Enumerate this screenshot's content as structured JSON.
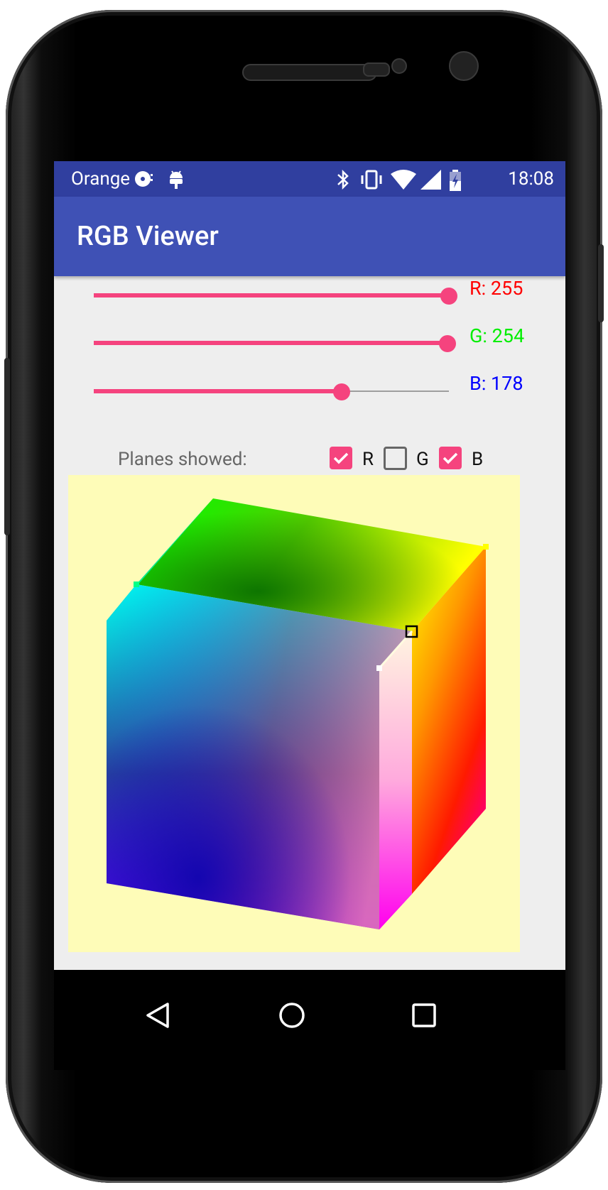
{
  "status_bar": {
    "carrier": "Orange",
    "time": "18:08"
  },
  "app_bar": {
    "title": "RGB Viewer"
  },
  "sliders": [
    {
      "label": "R: 255",
      "value": 255,
      "max": 255,
      "color": "#ff0000"
    },
    {
      "label": "G: 254",
      "value": 254,
      "max": 255,
      "color": "#00ee00"
    },
    {
      "label": "B: 178",
      "value": 178,
      "max": 255,
      "color": "#0000ff"
    }
  ],
  "planes": {
    "label": "Planes showed:",
    "options": [
      {
        "name": "R",
        "checked": true
      },
      {
        "name": "G",
        "checked": false
      },
      {
        "name": "B",
        "checked": true
      }
    ]
  },
  "colors": {
    "accent": "#f5437e",
    "primary": "#3f51b5",
    "primary_dark": "#303f9f",
    "canvas": "#fefcb8"
  }
}
